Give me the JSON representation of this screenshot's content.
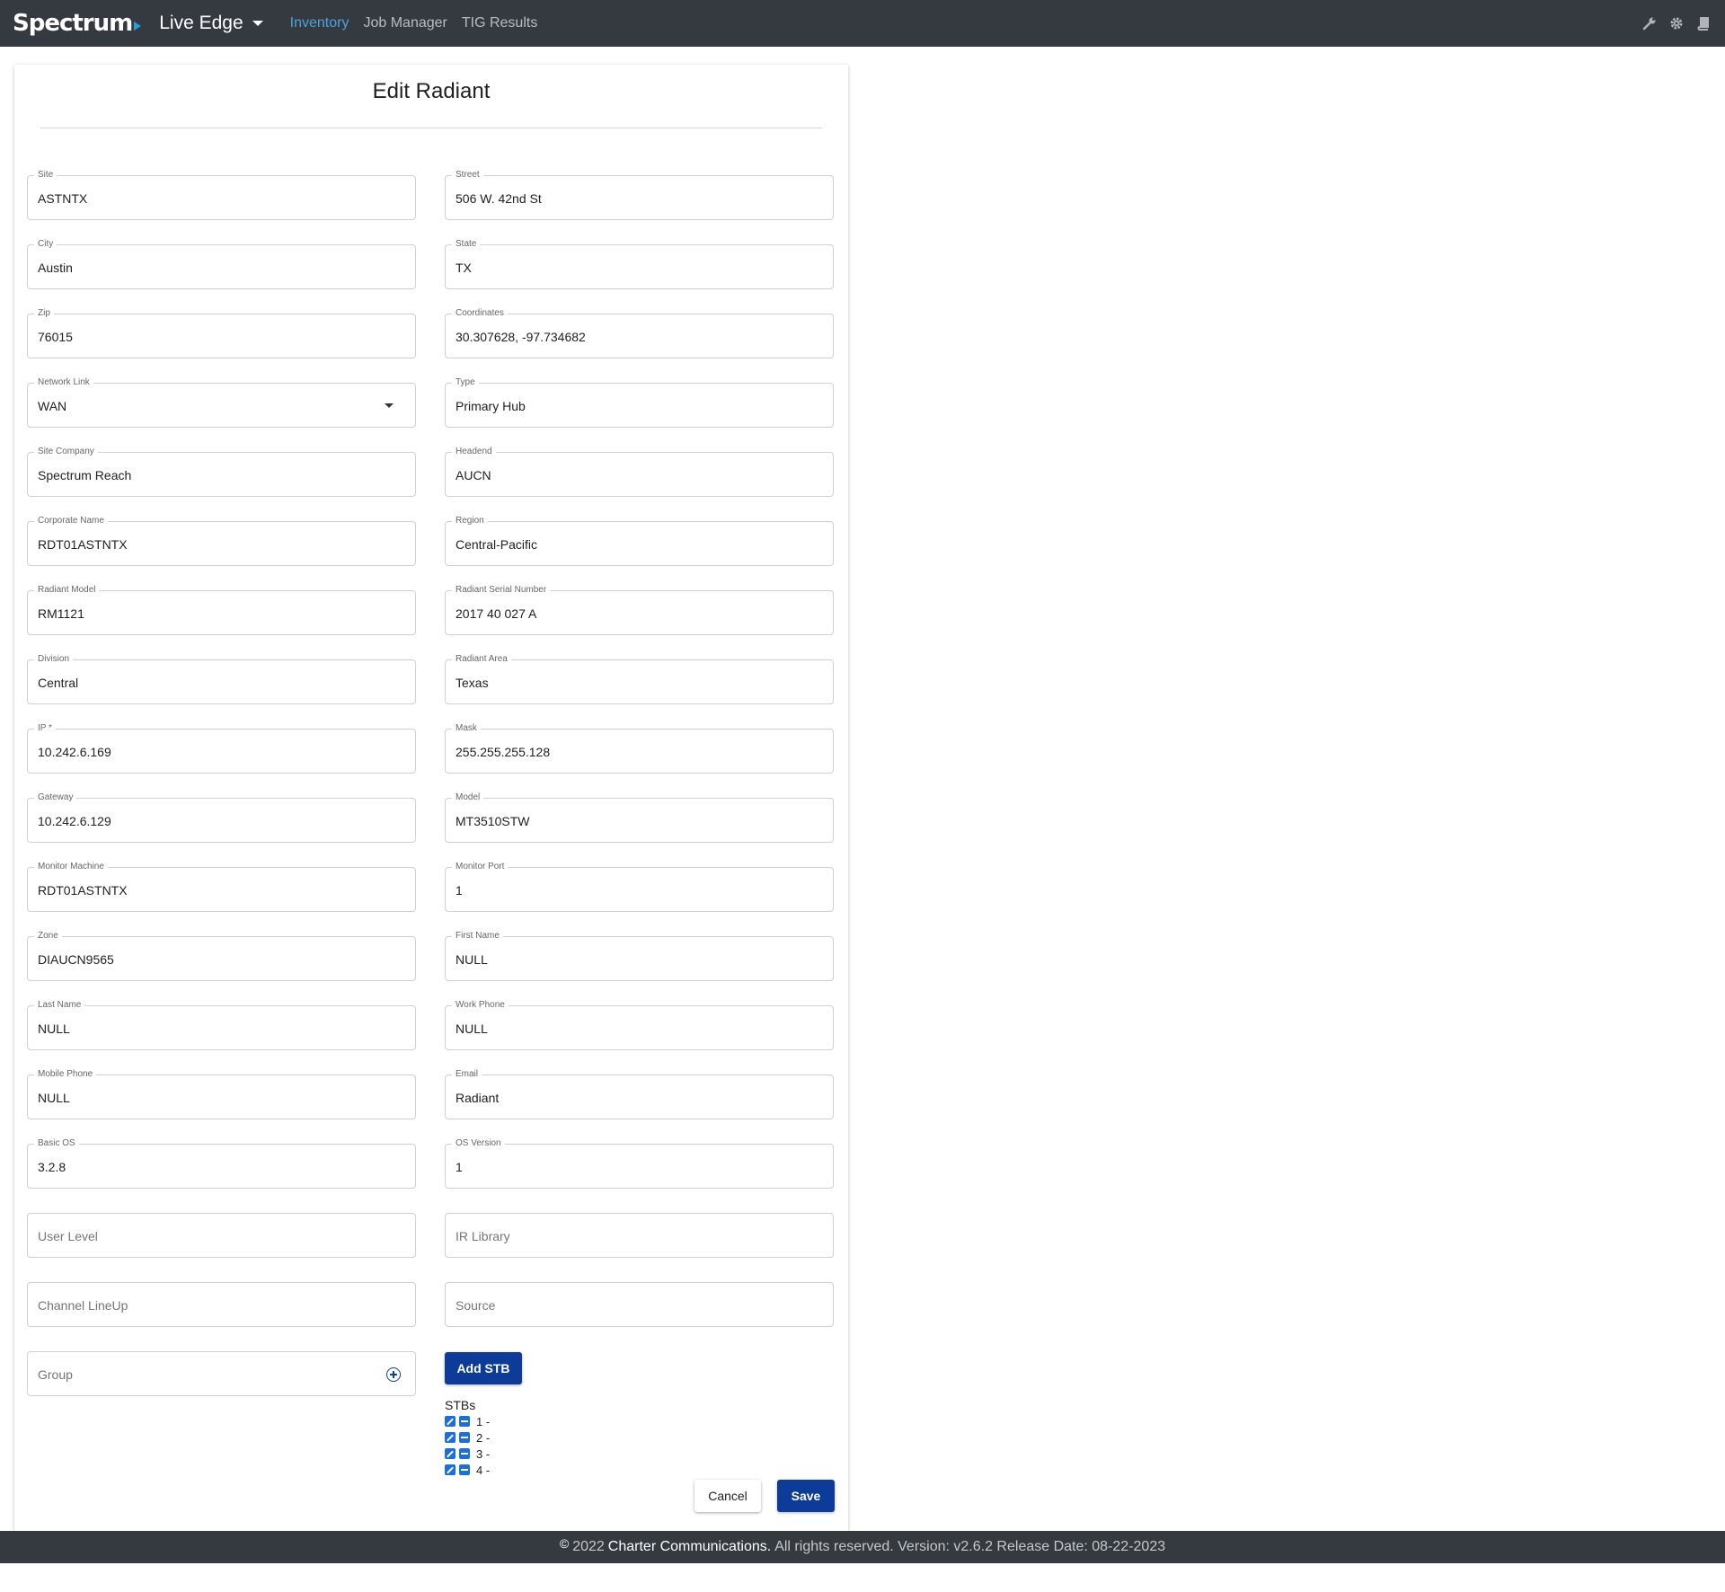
{
  "topbar": {
    "brand": "Spectrum",
    "app_name": "Live Edge",
    "nav": [
      "Inventory",
      "Job Manager",
      "TIG Results"
    ],
    "active_nav": "Inventory",
    "icons": [
      "wrench-icon",
      "gear-icon",
      "book-icon"
    ]
  },
  "form": {
    "title": "Edit Radiant",
    "fields": {
      "site": {
        "label": "Site",
        "value": "ASTNTX"
      },
      "street": {
        "label": "Street",
        "value": "506 W. 42nd St"
      },
      "city": {
        "label": "City",
        "value": "Austin"
      },
      "state": {
        "label": "State",
        "value": "TX"
      },
      "zip": {
        "label": "Zip",
        "value": "76015"
      },
      "coordinates": {
        "label": "Coordinates",
        "value": "30.307628, -97.734682"
      },
      "network_link": {
        "label": "Network Link",
        "value": "WAN"
      },
      "type": {
        "label": "Type",
        "value": "Primary Hub"
      },
      "site_company": {
        "label": "Site Company",
        "value": "Spectrum Reach"
      },
      "headend": {
        "label": "Headend",
        "value": "AUCN"
      },
      "corporate_name": {
        "label": "Corporate Name",
        "value": "RDT01ASTNTX"
      },
      "region": {
        "label": "Region",
        "value": "Central-Pacific"
      },
      "radiant_model": {
        "label": "Radiant Model",
        "value": "RM1121"
      },
      "radiant_serial": {
        "label": "Radiant Serial Number",
        "value": "2017 40 027 A"
      },
      "division": {
        "label": "Division",
        "value": "Central"
      },
      "radiant_area": {
        "label": "Radiant Area",
        "value": "Texas"
      },
      "ip": {
        "label": "IP *",
        "value": "10.242.6.169"
      },
      "mask": {
        "label": "Mask",
        "value": "255.255.255.128"
      },
      "gateway": {
        "label": "Gateway",
        "value": "10.242.6.129"
      },
      "model": {
        "label": "Model",
        "value": "MT3510STW"
      },
      "monitor_machine": {
        "label": "Monitor Machine",
        "value": "RDT01ASTNTX"
      },
      "monitor_port": {
        "label": "Monitor Port",
        "value": "1"
      },
      "zone": {
        "label": "Zone",
        "value": "DIAUCN9565"
      },
      "first_name": {
        "label": "First Name",
        "value": "NULL"
      },
      "last_name": {
        "label": "Last Name",
        "value": "NULL"
      },
      "work_phone": {
        "label": "Work Phone",
        "value": "NULL"
      },
      "mobile_phone": {
        "label": "Mobile Phone",
        "value": "NULL"
      },
      "email": {
        "label": "Email",
        "value": "Radiant"
      },
      "basic_os": {
        "label": "Basic OS",
        "value": "3.2.8"
      },
      "os_version": {
        "label": "OS Version",
        "value": "1"
      }
    },
    "placeholders": {
      "user_level": "User Level",
      "ir_library": "IR Library",
      "channel_lineup": "Channel LineUp",
      "source": "Source",
      "group": "Group"
    },
    "add_stb_label": "Add STB",
    "stbs_title": "STBs",
    "stbs": [
      "1 -",
      "2 -",
      "3 -",
      "4 -"
    ],
    "cancel_label": "Cancel",
    "save_label": "Save"
  },
  "footer": {
    "copyright_symbol": "©",
    "year": "2022",
    "company": "Charter Communications.",
    "rest": "All rights reserved. Version: v2.6.2 Release Date: 08-22-2023"
  }
}
